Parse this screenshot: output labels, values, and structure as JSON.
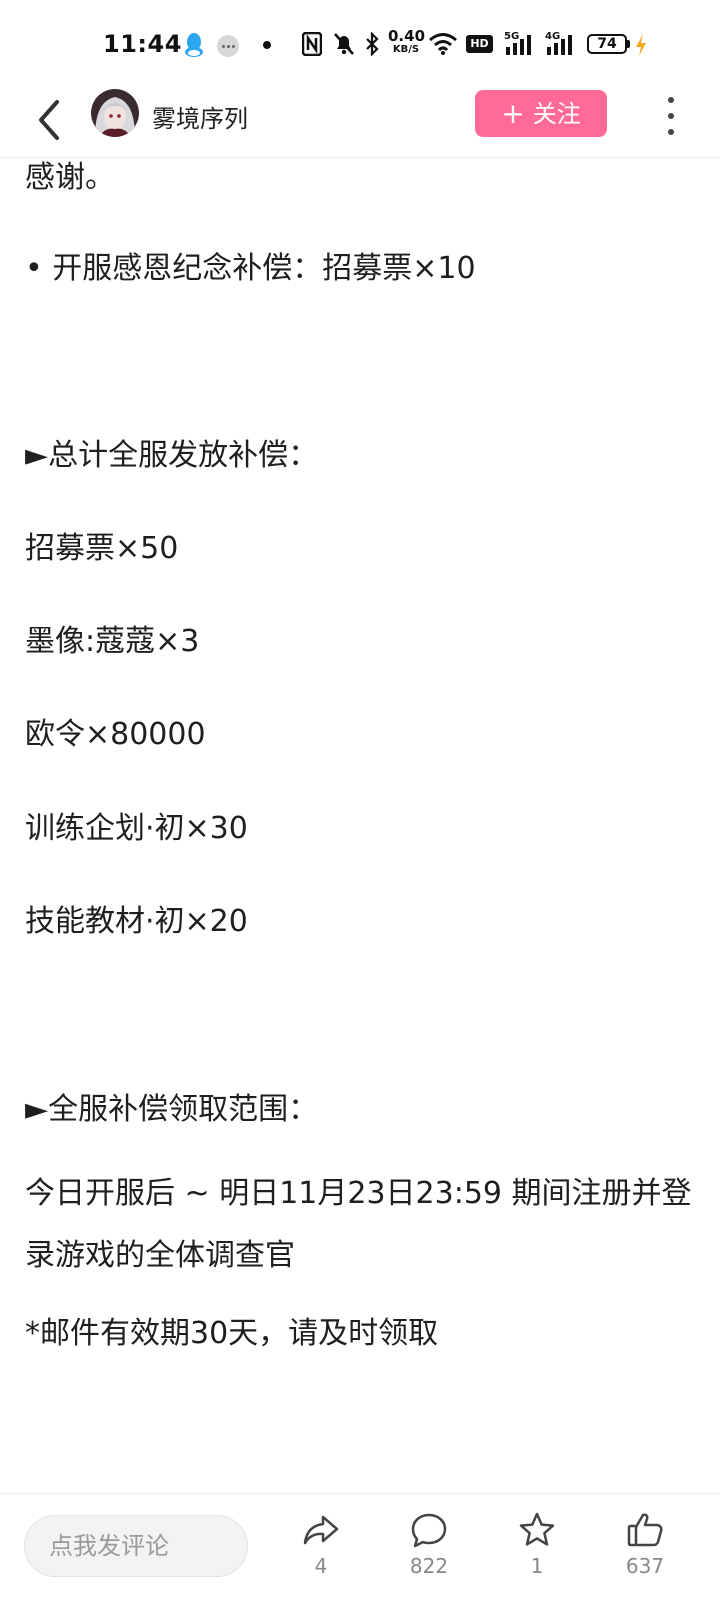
{
  "status_bar": {
    "time": "11:44",
    "net_speed_value": "0.40",
    "net_speed_unit": "KB/S",
    "hd_label": "HD",
    "sim1_label": "5G",
    "sim2_label": "4G",
    "battery": "74"
  },
  "header": {
    "author_name": "雾境序列",
    "follow_label": "关注",
    "follow_plus": "+"
  },
  "article": {
    "paragraphs": [
      "感谢。",
      "• 开服感恩纪念补偿：招募票×10",
      "►总计全服发放补偿：",
      "招募票×50",
      "墨像:蔻蔻×3",
      "欧令×80000",
      "训练企划·初×30",
      "技能教材·初×20",
      "►全服补偿领取范围：",
      "今日开服后 ~ 明日11月23日23:59 期间注册并登录游戏的全体调查官",
      "*邮件有效期30天，请及时领取"
    ]
  },
  "bottom_bar": {
    "comment_placeholder": "点我发评论",
    "share_count": "4",
    "comment_count": "822",
    "favorite_count": "1",
    "like_count": "637"
  },
  "colors": {
    "follow_button": "#ff6b96",
    "text": "#1f1f1f",
    "muted": "#888888"
  },
  "icons": [
    "qq-icon",
    "more-notification-icon",
    "nfc-icon",
    "mute-icon",
    "bluetooth-icon",
    "wifi-icon",
    "signal-icon",
    "battery-icon",
    "charging-icon",
    "back-arrow-icon",
    "more-vertical-icon",
    "share-icon",
    "comment-icon",
    "star-icon",
    "thumbs-up-icon"
  ]
}
